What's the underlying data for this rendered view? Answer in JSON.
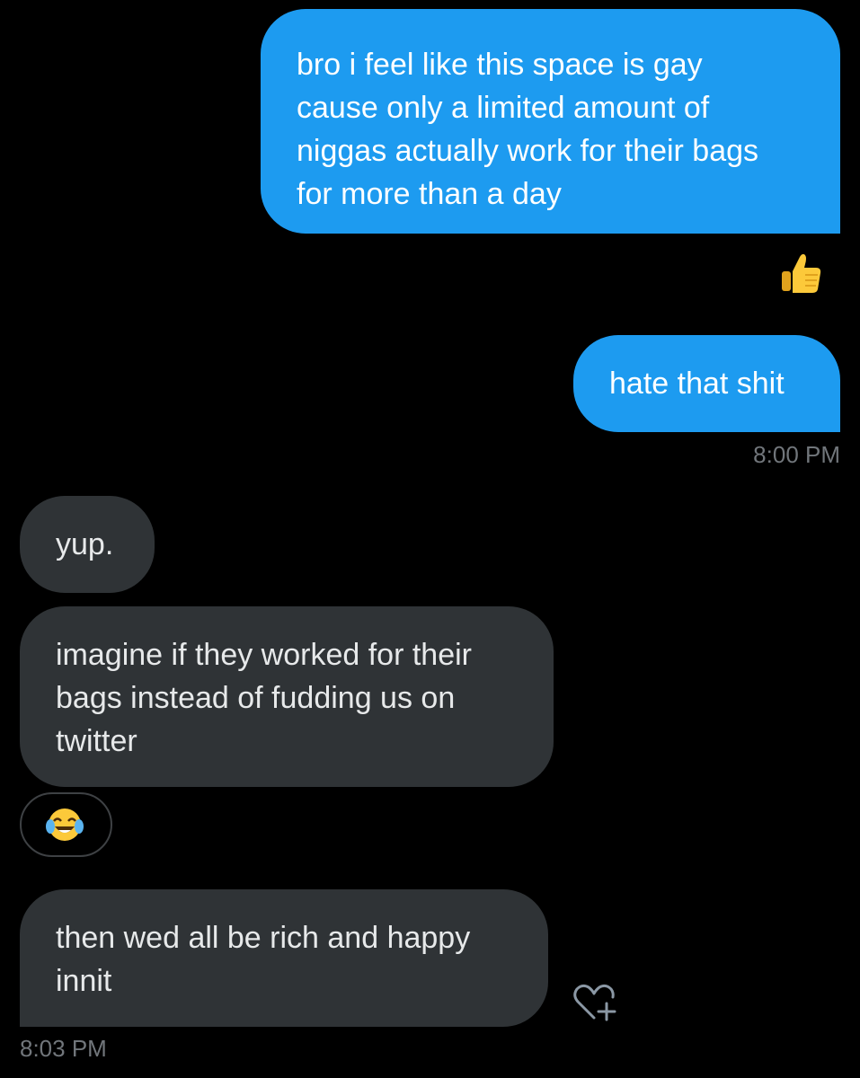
{
  "conversation": {
    "messages": [
      {
        "direction": "outgoing",
        "text": "bro i feel like this space is gay\ncause only a limited amount of\nniggas actually work for their bags\nfor more than a day",
        "reaction": "thumbs-up"
      },
      {
        "direction": "outgoing",
        "text": "hate that shit",
        "timestamp": "8:00 PM"
      },
      {
        "direction": "incoming",
        "text": "yup."
      },
      {
        "direction": "incoming",
        "text": "imagine if they worked for their\nbags instead of fudding us on\ntwitter",
        "reaction": "tears-of-joy"
      },
      {
        "direction": "incoming",
        "text": "then wed all be rich and happy\ninnit",
        "timestamp": "8:03 PM",
        "action_icon": "heart-plus-icon"
      }
    ]
  },
  "colors": {
    "background": "#000000",
    "outgoing_bubble": "#1d9bf0",
    "incoming_bubble": "#2f3336",
    "timestamp": "#71767b"
  }
}
